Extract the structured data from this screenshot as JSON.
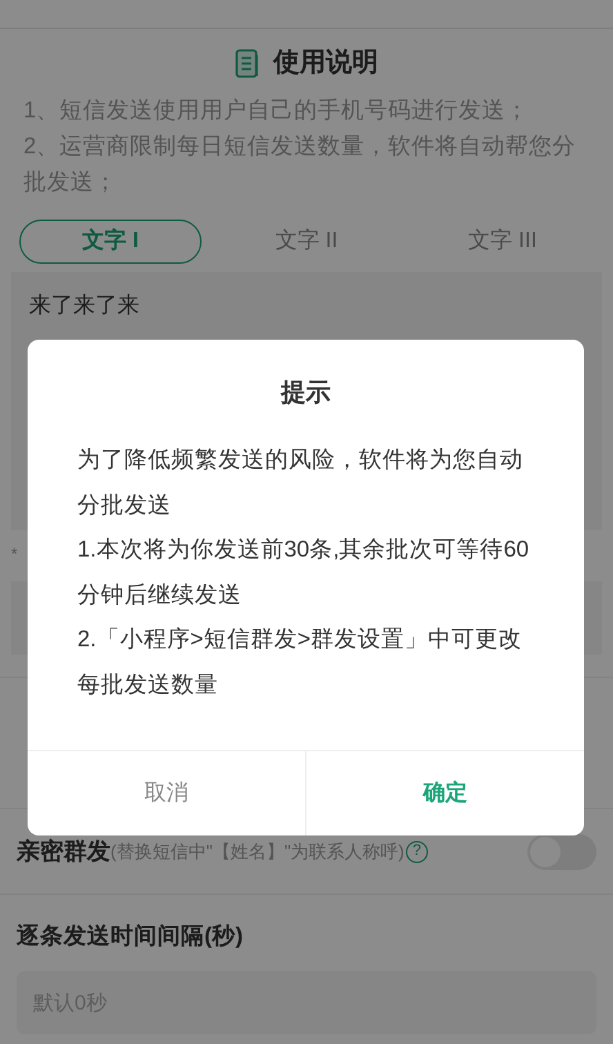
{
  "page": {
    "title": "使用说明",
    "instructions": [
      "1、短信发送使用用户自己的手机号码进行发送；",
      "2、运营商限制每日短信发送数量，软件将自动帮您分批发送；"
    ],
    "tabs": [
      {
        "label": "文字 I",
        "selected": true
      },
      {
        "label": "文字 II",
        "selected": false
      },
      {
        "label": "文字 III",
        "selected": false
      }
    ],
    "message": {
      "value": "来了来了来"
    },
    "note_mark": "*",
    "intimate": {
      "label": "亲密群发",
      "hint": "(替换短信中\"【姓名】\"为联系人称呼)",
      "help": "?",
      "on": false
    },
    "interval": {
      "label": "逐条发送时间间隔(秒)",
      "placeholder": "默认0秒"
    }
  },
  "dialog": {
    "title": "提示",
    "paragraphs": [
      "为了降低频繁发送的风险，软件将为您自动分批发送",
      "1.本次将为你发送前30条,其余批次可等待60分钟后继续发送",
      "2.「小程序>短信群发>群发设置」中可更改每批发送数量"
    ],
    "buttons": [
      {
        "label": "取消",
        "kind": "cancel"
      },
      {
        "label": "确定",
        "kind": "confirm"
      }
    ]
  }
}
